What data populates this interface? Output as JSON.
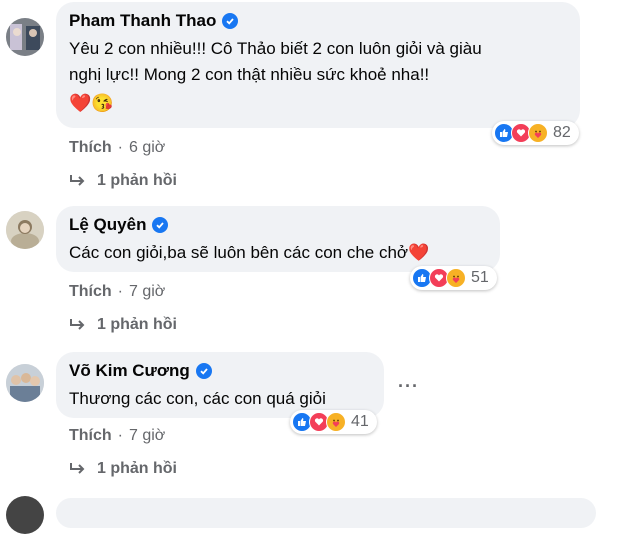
{
  "comments": [
    {
      "name": "Pham Thanh Thao",
      "text_line1": "Yêu 2 con nhiều!!! Cô Thảo biết 2 con luôn giỏi và giàu",
      "text_line2": "nghị lực!! Mong 2 con thật nhiều sức khoẻ nha!!",
      "emoji": "❤️😘",
      "like_label": "Thích",
      "dot": "·",
      "time": "6 giờ",
      "reaction_count": "82",
      "replies": "1 phản hồi"
    },
    {
      "name": "Lệ Quyên",
      "text_line1": "Các con giỏi,ba sẽ luôn bên các con che chở❤️",
      "like_label": "Thích",
      "dot": "·",
      "time": "7 giờ",
      "reaction_count": "51",
      "replies": "1 phản hồi"
    },
    {
      "name": "Võ Kim Cương",
      "text_line1": "Thương các con, các con quá giỏi",
      "like_label": "Thích",
      "dot": "·",
      "time": "7 giờ",
      "reaction_count": "41",
      "replies": "1 phản hồi",
      "more": "···"
    }
  ],
  "colors": {
    "bubble": "#f0f2f5",
    "secondary_text": "#65676b",
    "like_blue": "#1877f2",
    "love_red": "#f33e58",
    "care_yellow": "#f7b125"
  }
}
